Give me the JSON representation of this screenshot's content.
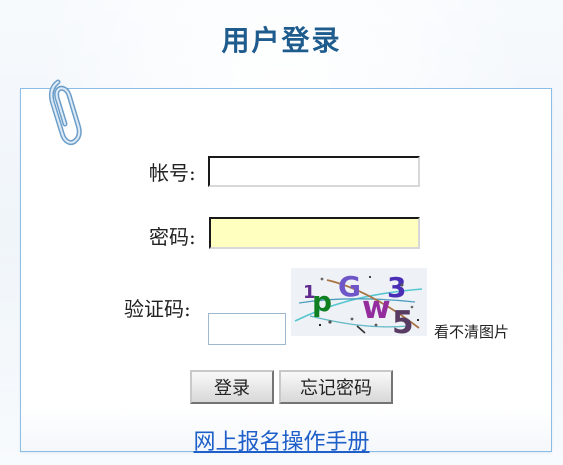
{
  "header": {
    "title": "用户登录"
  },
  "form": {
    "account_label": "帐号:",
    "password_label": "密码:",
    "captcha_label": "验证码:",
    "account_value": "",
    "password_value": "",
    "captcha_value": ""
  },
  "captcha_help": {
    "refresh_text": "看不清图片"
  },
  "buttons": {
    "login_label": "登录",
    "forgot_label": "忘记密码"
  },
  "footer": {
    "manual_link": "网上报名操作手册"
  },
  "icons": {
    "paperclip": "paperclip-icon"
  },
  "colors": {
    "title": "#1f5c8e",
    "panel_border": "#8cbde6",
    "password_fill": "#ffffc0",
    "link": "#1e5fc9"
  }
}
